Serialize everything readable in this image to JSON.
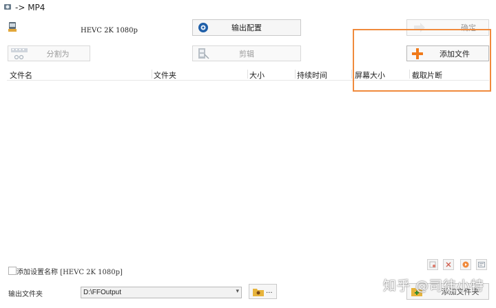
{
  "window": {
    "title": "-> MP4"
  },
  "preset": {
    "text": "HEVC 2K 1080p"
  },
  "toolbar": {
    "output_config": "输出配置",
    "ok": "确定",
    "split": "分割为",
    "clip": "剪辑",
    "add_file": "添加文件"
  },
  "columns": [
    "文件名",
    "文件夹",
    "大小",
    "持续时间",
    "屏幕大小",
    "截取片断"
  ],
  "bottom": {
    "add_setting_label": "添加设置名称 [HEVC 2K 1080p]",
    "output_folder_label": "输出文件夹",
    "output_folder_value": "D:\\FFOutput",
    "browse_dots": "...",
    "add_folder_label": "添加文件夹"
  },
  "watermark": "知乎 @司徒小特",
  "colors": {
    "highlight": "#f08a3c",
    "add_plus": "#f07a1a"
  }
}
